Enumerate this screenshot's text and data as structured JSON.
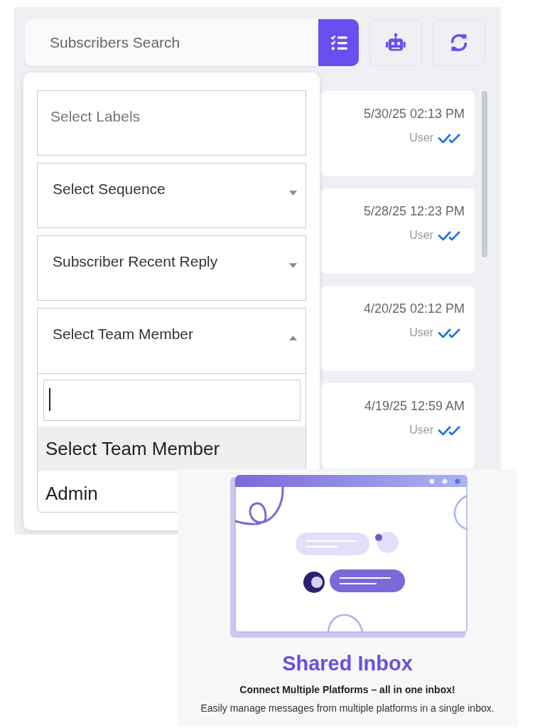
{
  "search": {
    "placeholder": "Subscribers Search"
  },
  "toolbar": [
    {
      "kind": "filter",
      "selected": true
    },
    {
      "kind": "robot",
      "selected": false
    },
    {
      "kind": "refresh",
      "selected": false
    }
  ],
  "conversations": [
    {
      "time": "5/30/25 02:13 PM",
      "sender": "User",
      "read": true
    },
    {
      "time": "5/28/25 12:23 PM",
      "sender": "User",
      "read": true
    },
    {
      "time": "4/20/25 02:12 PM",
      "sender": "User",
      "read": true
    },
    {
      "time": "4/19/25 12:59 AM",
      "sender": "User",
      "read": true
    }
  ],
  "filters": [
    {
      "kind": "text",
      "placeholder": "Select Labels"
    },
    {
      "kind": "select",
      "value": "Select Sequence",
      "expanded": false
    },
    {
      "kind": "select",
      "value": "Subscriber Recent Reply",
      "expanded": false
    },
    {
      "kind": "select",
      "value": "Select Team Member",
      "expanded": true,
      "options": [
        {
          "label": "Select Team Member",
          "selected": true
        },
        {
          "label": "Admin",
          "selected": false
        }
      ]
    }
  ],
  "promo": {
    "title": "Shared Inbox",
    "subtitle": "Connect Multiple Platforms – all in one inbox!",
    "description": "Easily manage messages from multiple platforms in a single inbox."
  }
}
